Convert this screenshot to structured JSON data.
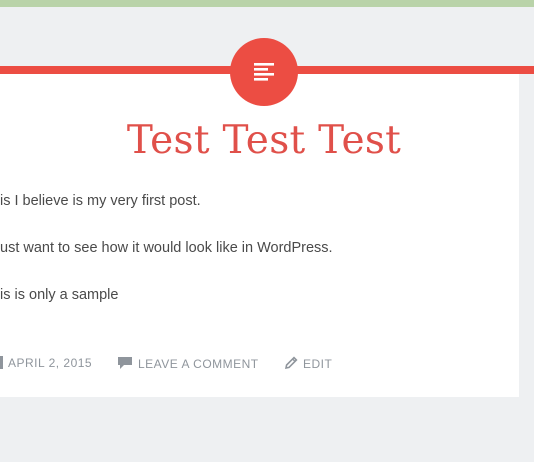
{
  "post": {
    "title": "Test Test Test",
    "paragraphs": [
      "is I believe is my very first post.",
      "ust want to see how it would look like in WordPress.",
      "is is only a sample"
    ],
    "meta": {
      "date": "APRIL 2, 2015",
      "comment_link": "LEAVE A COMMENT",
      "edit_link": "EDIT"
    }
  },
  "colors": {
    "accent": "#ec4d43",
    "title": "#e0504a",
    "background": "#eef0f2",
    "top_strip": "#b9d3a9"
  },
  "icons": {
    "format": "standard-post-icon",
    "date": "calendar-icon",
    "comment": "comment-bubble-icon",
    "edit": "pencil-icon"
  }
}
